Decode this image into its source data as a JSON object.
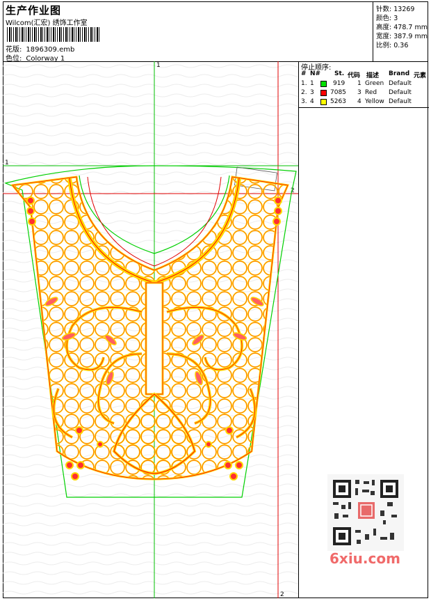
{
  "header": {
    "title": "生产作业图",
    "subtitle": "Wilcom(汇宏) 绣饰工作室",
    "design_label": "花版:",
    "design_value": "1896309.emb",
    "colorway_label": "色位:",
    "colorway_value": "Colorway 1"
  },
  "stats": {
    "stitches_label": "针数:",
    "stitches": "13269",
    "colors_label": "颜色:",
    "colors": "3",
    "height_label": "高度:",
    "height": "478.7 mm",
    "width_label": "宽度:",
    "width": "387.9 mm",
    "scale_label": "比例:",
    "scale": "0.36"
  },
  "stop_sequence": {
    "heading": "停止顺序:",
    "columns": [
      "#",
      "N#",
      "St.",
      "代码",
      "描述",
      "Brand",
      "元素"
    ],
    "rows": [
      {
        "idx": "1.",
        "n": "1",
        "color": "#00e000",
        "st": "919",
        "code": "1",
        "desc": "Green",
        "brand": "Default"
      },
      {
        "idx": "2.",
        "n": "3",
        "color": "#ff0000",
        "st": "7085",
        "code": "3",
        "desc": "Red",
        "brand": "Default"
      },
      {
        "idx": "3.",
        "n": "4",
        "color": "#ffff00",
        "st": "5263",
        "code": "4",
        "desc": "Yellow",
        "brand": "Default"
      }
    ]
  },
  "guides": {
    "top_label": "1",
    "left_label": "1",
    "right_label": "2",
    "bottom_label": "2"
  },
  "watermark": {
    "text": "6xiu.com"
  },
  "palette": {
    "green": "#00d000",
    "red": "#ff0000",
    "yellow": "#ffd800",
    "orange": "#e08000"
  }
}
